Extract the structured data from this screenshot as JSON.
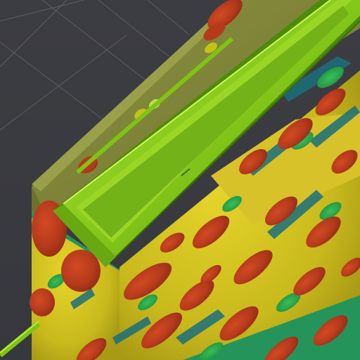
{
  "scene": {
    "background_color": "#3a3b40",
    "grid_color": "#6a6c72",
    "plate_color": "#7e8637",
    "rail_color": "#7fc414",
    "rail_highlight": "#b5ee3a",
    "rail_shadow": "#4d8a0a",
    "heat_colors": {
      "low": "#1a6f7c",
      "mid_low": "#2aa84a",
      "mid": "#c4c11b",
      "mid_high": "#d8b91f",
      "high": "#b53a1c"
    }
  }
}
